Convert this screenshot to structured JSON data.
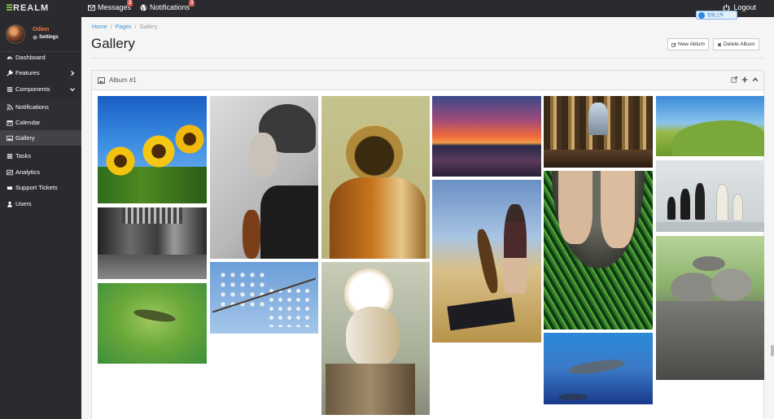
{
  "topbar": {
    "brand": "REALM",
    "messages_label": "Messages",
    "messages_count": "2",
    "notifications_label": "Notifications",
    "notifications_count": "3",
    "logout_label": "Logout",
    "floating_tag": "智能上传"
  },
  "user": {
    "name": "Odinn",
    "settings_label": "Settings"
  },
  "sidebar": {
    "items": [
      {
        "label": "Dashboard",
        "icon": "dashboard-icon"
      },
      {
        "label": "Features",
        "icon": "wrench-icon"
      },
      {
        "label": "Components",
        "icon": "list-icon"
      },
      {
        "label": "Notifications",
        "icon": "rss-icon"
      },
      {
        "label": "Calendar",
        "icon": "calendar-icon"
      },
      {
        "label": "Gallery",
        "icon": "picture-icon"
      },
      {
        "label": "Tasks",
        "icon": "tasks-icon"
      },
      {
        "label": "Analytics",
        "icon": "chart-icon"
      },
      {
        "label": "Support Tickets",
        "icon": "ticket-icon"
      },
      {
        "label": "Users",
        "icon": "user-icon"
      }
    ]
  },
  "breadcrumb": {
    "home": "Home",
    "pages": "Pages",
    "current": "Gallery"
  },
  "page": {
    "title": "Gallery",
    "new_album": "New Ablum",
    "delete_album": "Delete Album"
  },
  "album": {
    "title": "Album #1"
  },
  "colors": {
    "sidebar_bg": "#2b2b2f",
    "accent_link": "#3a8ed0",
    "badge": "#d9534f",
    "username": "#e87a4a"
  }
}
